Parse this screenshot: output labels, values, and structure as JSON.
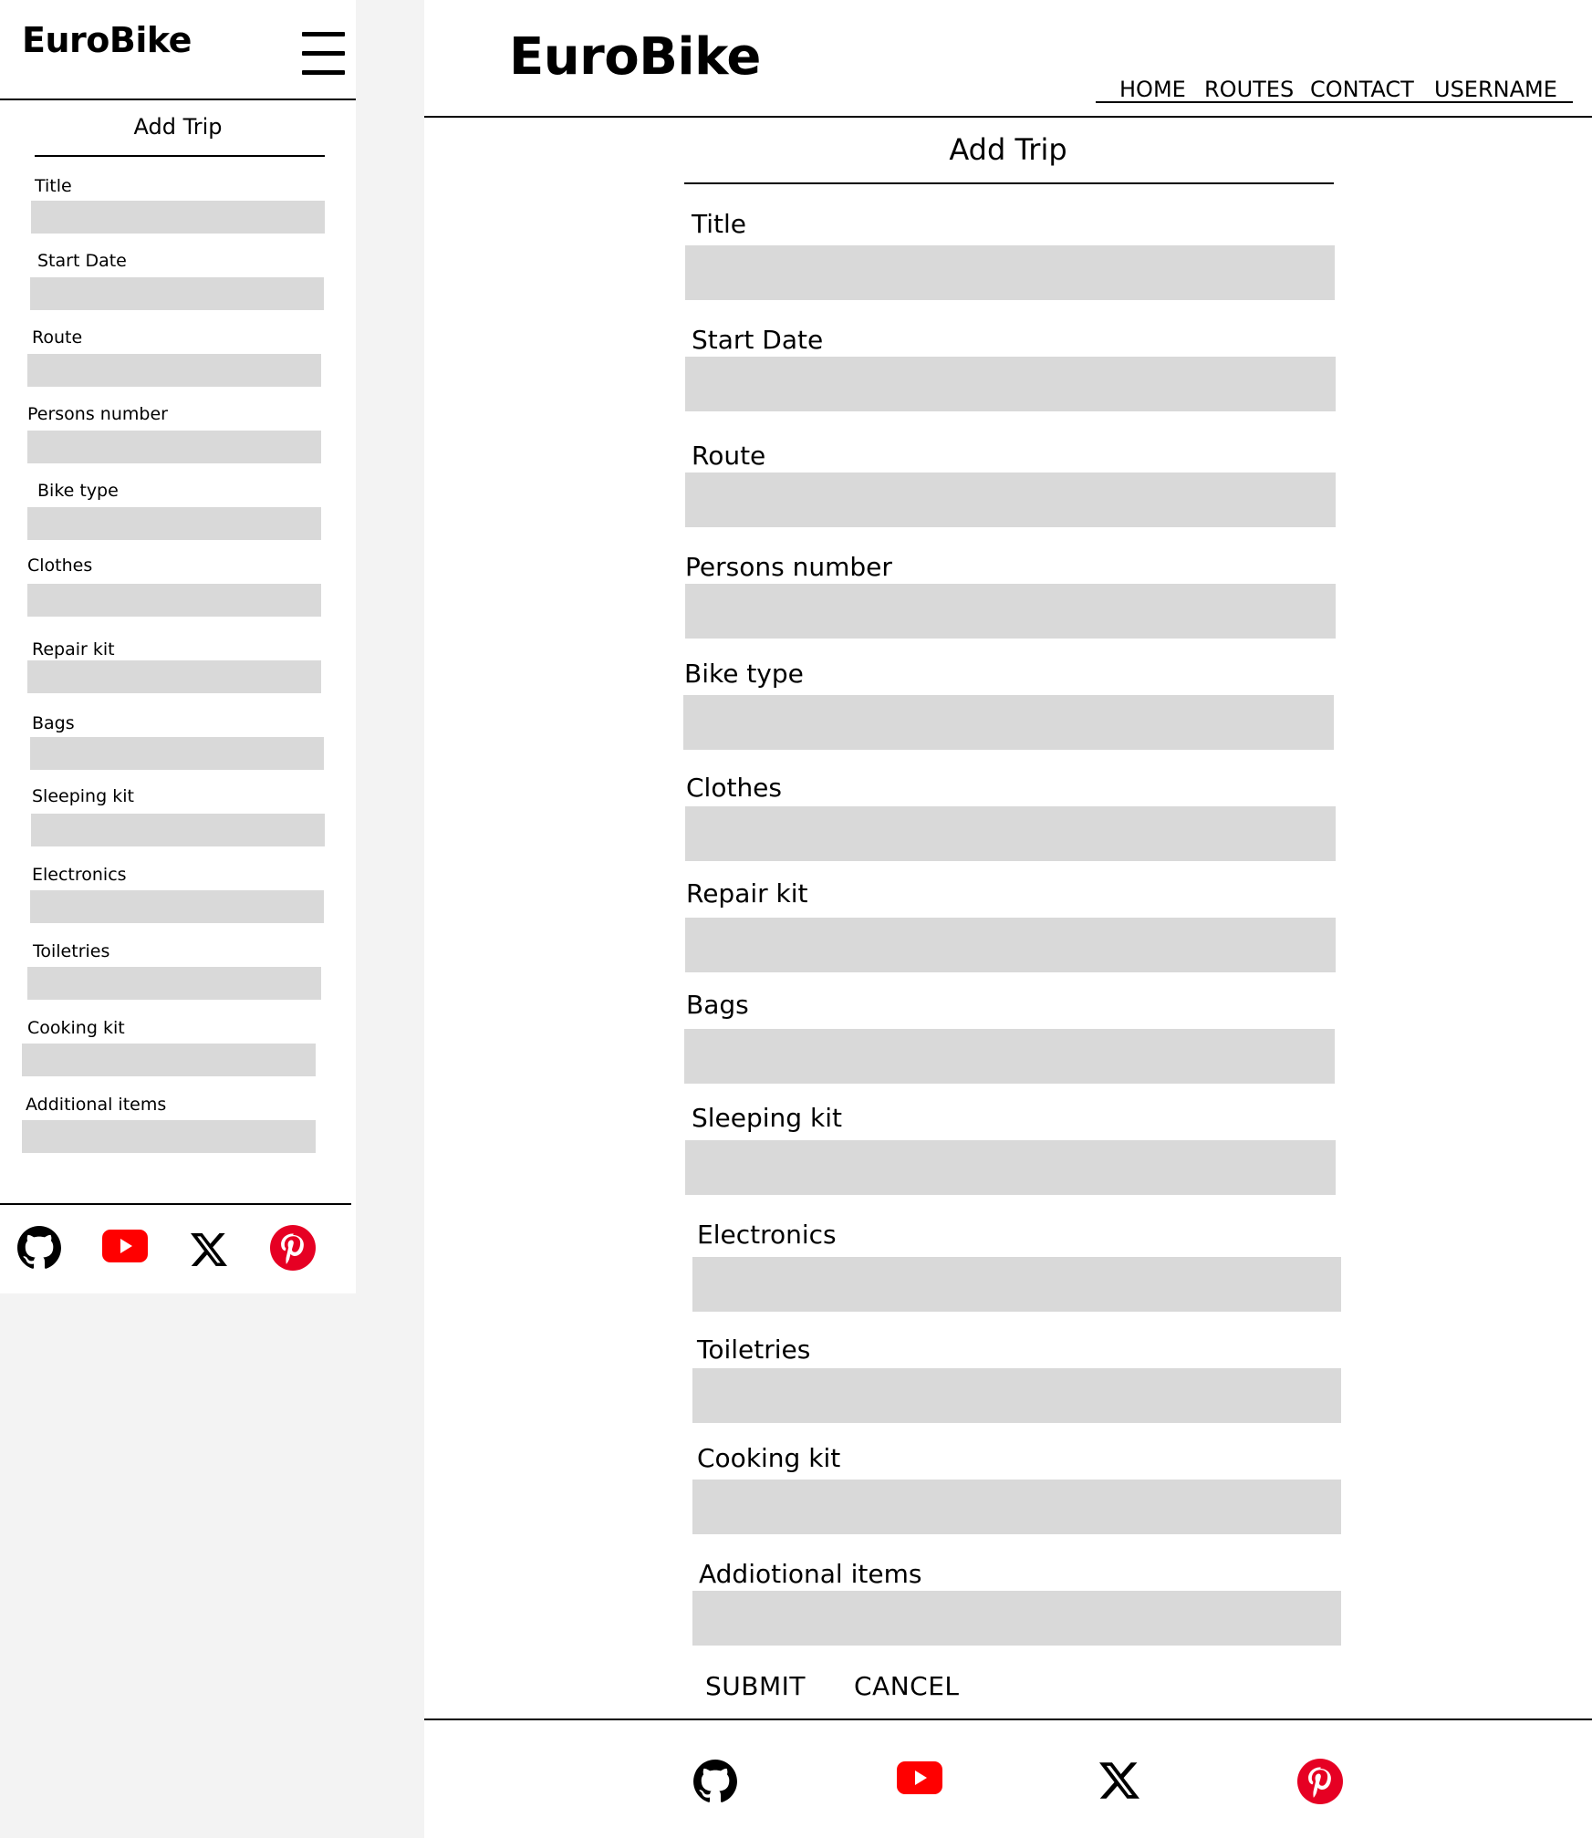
{
  "brand": "EuroBike",
  "page_title": "Add Trip",
  "nav": [
    "HOME",
    "ROUTES",
    "CONTACT",
    "USERNAME"
  ],
  "mobile_fields": [
    "Title",
    "Start Date",
    "Route",
    "Persons number",
    "Bike type",
    "Clothes",
    "Repair kit",
    "Bags",
    "Sleeping kit",
    "Electronics",
    "Toiletries",
    "Cooking kit",
    "Additional items"
  ],
  "desktop_fields": [
    "Title",
    "Start Date",
    "Route",
    "Persons number",
    "Bike type",
    "Clothes",
    "Repair kit",
    "Bags",
    "Sleeping kit",
    "Electronics",
    "Toiletries",
    "Cooking kit",
    "Addiotional items"
  ],
  "buttons": {
    "submit": "SUBMIT",
    "cancel": "CANCEL"
  },
  "social_icons": [
    "github-icon",
    "youtube-icon",
    "x-icon",
    "pinterest-icon"
  ],
  "colors": {
    "field_bg": "#d9d9d9",
    "outer_bg": "#f3f3f3",
    "frame_bg": "#ffffff",
    "youtube": "#ff0000",
    "pinterest": "#e60023"
  }
}
